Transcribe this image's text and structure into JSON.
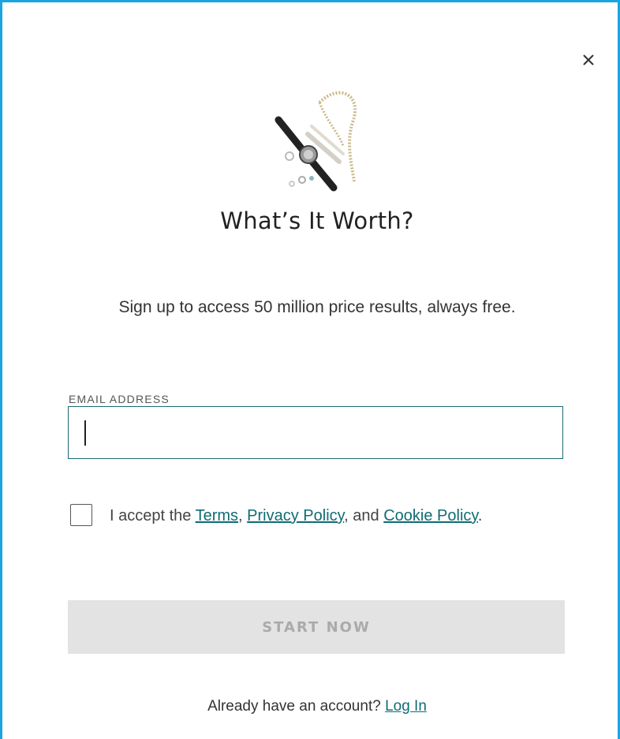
{
  "modal": {
    "close_symbol": "×",
    "illustration_icon": "jewelry-watch-illustration",
    "title": "What’s It Worth?",
    "subtitle": "Sign up to access 50 million price results, always free.",
    "email": {
      "label": "EMAIL ADDRESS",
      "value": "",
      "placeholder": ""
    },
    "consent": {
      "prefix": "I accept the ",
      "terms_link": "Terms",
      "sep1": ", ",
      "privacy_link": "Privacy Policy",
      "sep2": ", and ",
      "cookie_link": "Cookie Policy",
      "suffix": "."
    },
    "start_button": "START NOW",
    "login": {
      "prompt": "Already have an account? ",
      "link": "Log In"
    }
  },
  "colors": {
    "frame_border": "#1ba5e0",
    "accent_link": "#0f6c74",
    "button_disabled_bg": "#e3e3e3",
    "button_disabled_text": "#aaaaaa"
  }
}
